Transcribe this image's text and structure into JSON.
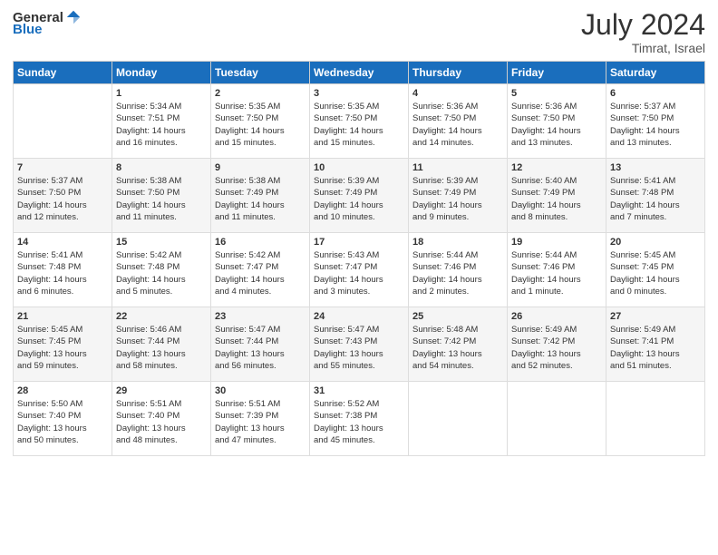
{
  "header": {
    "logo_general": "General",
    "logo_blue": "Blue",
    "title": "July 2024",
    "subtitle": "Timrat, Israel"
  },
  "days_of_week": [
    "Sunday",
    "Monday",
    "Tuesday",
    "Wednesday",
    "Thursday",
    "Friday",
    "Saturday"
  ],
  "weeks": [
    [
      {
        "day": "",
        "info": ""
      },
      {
        "day": "1",
        "info": "Sunrise: 5:34 AM\nSunset: 7:51 PM\nDaylight: 14 hours\nand 16 minutes."
      },
      {
        "day": "2",
        "info": "Sunrise: 5:35 AM\nSunset: 7:50 PM\nDaylight: 14 hours\nand 15 minutes."
      },
      {
        "day": "3",
        "info": "Sunrise: 5:35 AM\nSunset: 7:50 PM\nDaylight: 14 hours\nand 15 minutes."
      },
      {
        "day": "4",
        "info": "Sunrise: 5:36 AM\nSunset: 7:50 PM\nDaylight: 14 hours\nand 14 minutes."
      },
      {
        "day": "5",
        "info": "Sunrise: 5:36 AM\nSunset: 7:50 PM\nDaylight: 14 hours\nand 13 minutes."
      },
      {
        "day": "6",
        "info": "Sunrise: 5:37 AM\nSunset: 7:50 PM\nDaylight: 14 hours\nand 13 minutes."
      }
    ],
    [
      {
        "day": "7",
        "info": "Sunrise: 5:37 AM\nSunset: 7:50 PM\nDaylight: 14 hours\nand 12 minutes."
      },
      {
        "day": "8",
        "info": "Sunrise: 5:38 AM\nSunset: 7:50 PM\nDaylight: 14 hours\nand 11 minutes."
      },
      {
        "day": "9",
        "info": "Sunrise: 5:38 AM\nSunset: 7:49 PM\nDaylight: 14 hours\nand 11 minutes."
      },
      {
        "day": "10",
        "info": "Sunrise: 5:39 AM\nSunset: 7:49 PM\nDaylight: 14 hours\nand 10 minutes."
      },
      {
        "day": "11",
        "info": "Sunrise: 5:39 AM\nSunset: 7:49 PM\nDaylight: 14 hours\nand 9 minutes."
      },
      {
        "day": "12",
        "info": "Sunrise: 5:40 AM\nSunset: 7:49 PM\nDaylight: 14 hours\nand 8 minutes."
      },
      {
        "day": "13",
        "info": "Sunrise: 5:41 AM\nSunset: 7:48 PM\nDaylight: 14 hours\nand 7 minutes."
      }
    ],
    [
      {
        "day": "14",
        "info": "Sunrise: 5:41 AM\nSunset: 7:48 PM\nDaylight: 14 hours\nand 6 minutes."
      },
      {
        "day": "15",
        "info": "Sunrise: 5:42 AM\nSunset: 7:48 PM\nDaylight: 14 hours\nand 5 minutes."
      },
      {
        "day": "16",
        "info": "Sunrise: 5:42 AM\nSunset: 7:47 PM\nDaylight: 14 hours\nand 4 minutes."
      },
      {
        "day": "17",
        "info": "Sunrise: 5:43 AM\nSunset: 7:47 PM\nDaylight: 14 hours\nand 3 minutes."
      },
      {
        "day": "18",
        "info": "Sunrise: 5:44 AM\nSunset: 7:46 PM\nDaylight: 14 hours\nand 2 minutes."
      },
      {
        "day": "19",
        "info": "Sunrise: 5:44 AM\nSunset: 7:46 PM\nDaylight: 14 hours\nand 1 minute."
      },
      {
        "day": "20",
        "info": "Sunrise: 5:45 AM\nSunset: 7:45 PM\nDaylight: 14 hours\nand 0 minutes."
      }
    ],
    [
      {
        "day": "21",
        "info": "Sunrise: 5:45 AM\nSunset: 7:45 PM\nDaylight: 13 hours\nand 59 minutes."
      },
      {
        "day": "22",
        "info": "Sunrise: 5:46 AM\nSunset: 7:44 PM\nDaylight: 13 hours\nand 58 minutes."
      },
      {
        "day": "23",
        "info": "Sunrise: 5:47 AM\nSunset: 7:44 PM\nDaylight: 13 hours\nand 56 minutes."
      },
      {
        "day": "24",
        "info": "Sunrise: 5:47 AM\nSunset: 7:43 PM\nDaylight: 13 hours\nand 55 minutes."
      },
      {
        "day": "25",
        "info": "Sunrise: 5:48 AM\nSunset: 7:42 PM\nDaylight: 13 hours\nand 54 minutes."
      },
      {
        "day": "26",
        "info": "Sunrise: 5:49 AM\nSunset: 7:42 PM\nDaylight: 13 hours\nand 52 minutes."
      },
      {
        "day": "27",
        "info": "Sunrise: 5:49 AM\nSunset: 7:41 PM\nDaylight: 13 hours\nand 51 minutes."
      }
    ],
    [
      {
        "day": "28",
        "info": "Sunrise: 5:50 AM\nSunset: 7:40 PM\nDaylight: 13 hours\nand 50 minutes."
      },
      {
        "day": "29",
        "info": "Sunrise: 5:51 AM\nSunset: 7:40 PM\nDaylight: 13 hours\nand 48 minutes."
      },
      {
        "day": "30",
        "info": "Sunrise: 5:51 AM\nSunset: 7:39 PM\nDaylight: 13 hours\nand 47 minutes."
      },
      {
        "day": "31",
        "info": "Sunrise: 5:52 AM\nSunset: 7:38 PM\nDaylight: 13 hours\nand 45 minutes."
      },
      {
        "day": "",
        "info": ""
      },
      {
        "day": "",
        "info": ""
      },
      {
        "day": "",
        "info": ""
      }
    ]
  ]
}
